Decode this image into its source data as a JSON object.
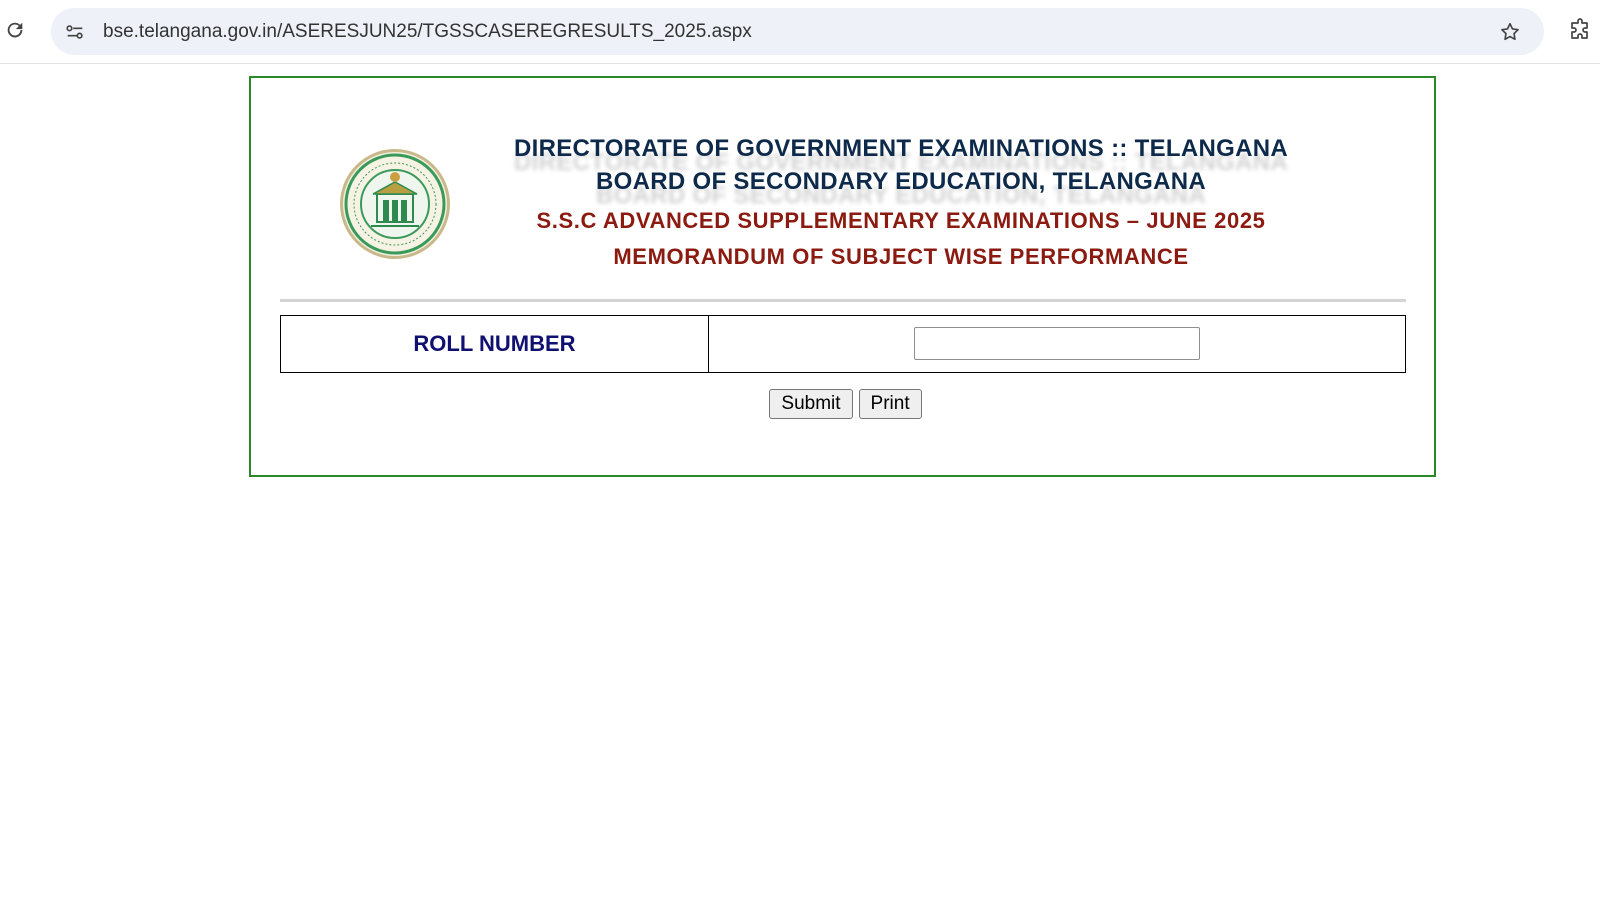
{
  "browser": {
    "url": "bse.telangana.gov.in/ASERESJUN25/TGSSCASEREGRESULTS_2025.aspx",
    "icons": {
      "reload": "reload-icon",
      "site_info": "site-info-icon",
      "bookmark": "star-icon",
      "extensions": "extensions-icon"
    }
  },
  "page": {
    "logo": "telangana-government-seal",
    "heading_1": "DIRECTORATE OF GOVERNMENT EXAMINATIONS :: TELANGANA",
    "heading_2": "BOARD OF SECONDARY EDUCATION, TELANGANA",
    "heading_3": "S.S.C ADVANCED SUPPLEMENTARY EXAMINATIONS – JUNE 2025",
    "heading_4": "MEMORANDUM OF SUBJECT WISE PERFORMANCE",
    "form": {
      "roll_number_label": "ROLL NUMBER",
      "roll_number_value": "",
      "submit_label": "Submit",
      "print_label": "Print"
    },
    "colors": {
      "panel_border": "#2a8a2a",
      "heading_navy": "#0e2a4a",
      "heading_maroon": "#8b1a10",
      "label_blue": "#101070"
    }
  }
}
